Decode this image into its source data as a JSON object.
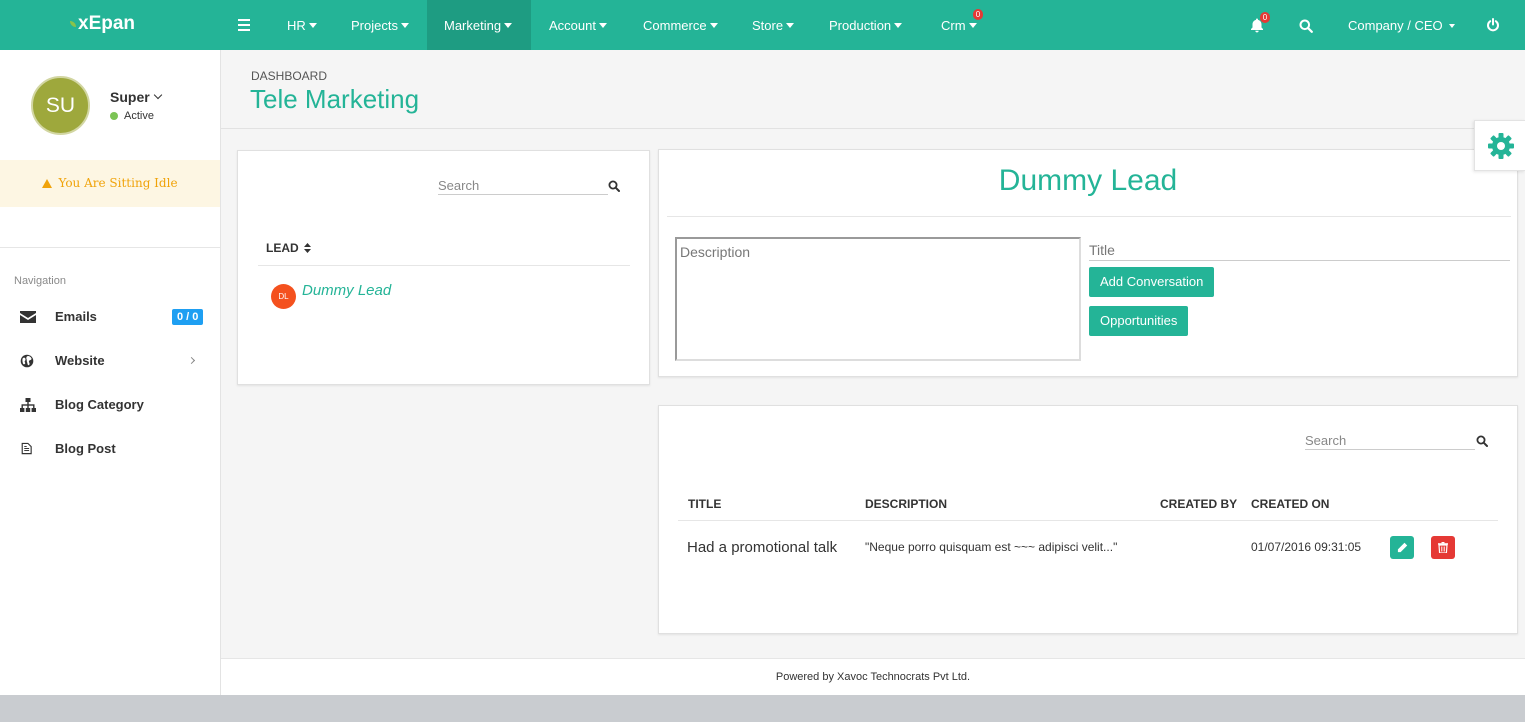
{
  "app": {
    "brand": "xEpan"
  },
  "topnav": {
    "items": [
      {
        "label": "HR"
      },
      {
        "label": "Projects"
      },
      {
        "label": "Marketing"
      },
      {
        "label": "Account"
      },
      {
        "label": "Commerce"
      },
      {
        "label": "Store"
      },
      {
        "label": "Production"
      },
      {
        "label": "Crm",
        "badge": "0"
      }
    ],
    "notification_count": "0",
    "user_menu": "Company / CEO"
  },
  "sidebar": {
    "avatar_initials": "SU",
    "user_name": "Super",
    "status": "Active",
    "idle_message": "You Are Sitting Idle",
    "nav_heading": "Navigation",
    "items": [
      {
        "label": "Emails",
        "badge": "0 / 0",
        "icon": "envelope-icon"
      },
      {
        "label": "Website",
        "icon": "globe-icon"
      },
      {
        "label": "Blog Category",
        "icon": "sitemap-icon"
      },
      {
        "label": "Blog Post",
        "icon": "document-icon"
      }
    ]
  },
  "page": {
    "breadcrumb": "DASHBOARD",
    "title": "Tele Marketing"
  },
  "lead_list": {
    "search_placeholder": "Search",
    "column_header": "LEAD",
    "leads": [
      {
        "initials": "DL",
        "name": "Dummy Lead"
      }
    ]
  },
  "lead_detail": {
    "name": "Dummy Lead",
    "description_placeholder": "Description",
    "title_placeholder": "Title",
    "add_conversation_label": "Add Conversation",
    "opportunities_label": "Opportunities"
  },
  "conversations": {
    "search_placeholder": "Search",
    "headers": {
      "title": "TITLE",
      "description": "DESCRIPTION",
      "created_by": "CREATED BY",
      "created_on": "CREATED ON"
    },
    "rows": [
      {
        "title": "Had a promotional talk",
        "description": "\"Neque porro quisquam est ~~~ adipisci velit...\"",
        "created_by": "",
        "created_on": "01/07/2016 09:31:05"
      }
    ]
  },
  "footer": {
    "text": "Powered by Xavoc Technocrats Pvt Ltd."
  },
  "colors": {
    "accent": "#24b497",
    "accent_dark": "#1e9c82",
    "danger": "#e53935",
    "warning": "#f0a30a",
    "info": "#1e9ff2"
  }
}
